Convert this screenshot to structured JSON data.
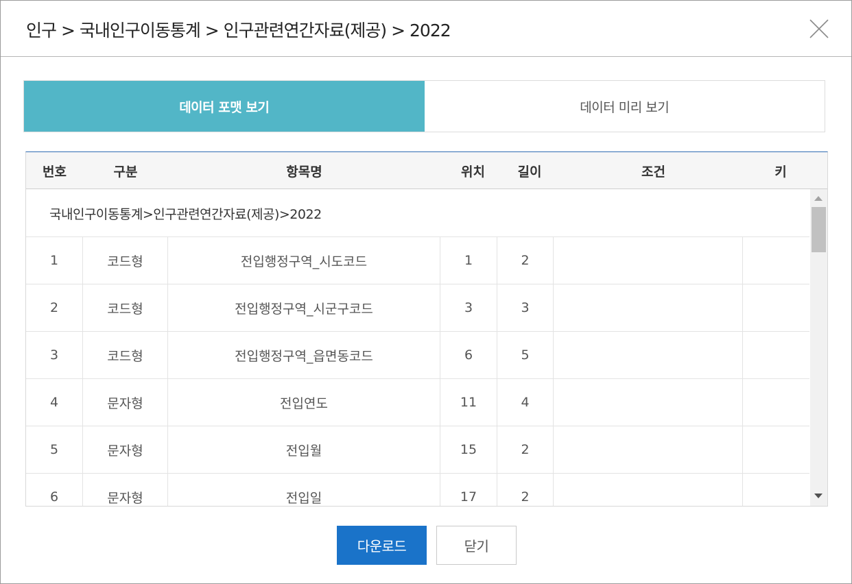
{
  "header": {
    "title": "인구 > 국내인구이동통계 > 인구관련연간자료(제공) > 2022",
    "close_icon": "close-icon"
  },
  "tabs": [
    {
      "label": "데이터 포맷 보기",
      "active": true
    },
    {
      "label": "데이터 미리 보기",
      "active": false
    }
  ],
  "table": {
    "columns": [
      "번호",
      "구분",
      "항목명",
      "위치",
      "길이",
      "조건",
      "키"
    ],
    "group_label": "국내인구이동통계>인구관련연간자료(제공)>2022",
    "rows": [
      {
        "no": "1",
        "type": "코드형",
        "name": "전입행정구역_시도코드",
        "pos": "1",
        "len": "2",
        "cond": "",
        "key": ""
      },
      {
        "no": "2",
        "type": "코드형",
        "name": "전입행정구역_시군구코드",
        "pos": "3",
        "len": "3",
        "cond": "",
        "key": ""
      },
      {
        "no": "3",
        "type": "코드형",
        "name": "전입행정구역_읍면동코드",
        "pos": "6",
        "len": "5",
        "cond": "",
        "key": ""
      },
      {
        "no": "4",
        "type": "문자형",
        "name": "전입연도",
        "pos": "11",
        "len": "4",
        "cond": "",
        "key": ""
      },
      {
        "no": "5",
        "type": "문자형",
        "name": "전입월",
        "pos": "15",
        "len": "2",
        "cond": "",
        "key": ""
      },
      {
        "no": "6",
        "type": "문자형",
        "name": "전입일",
        "pos": "17",
        "len": "2",
        "cond": "",
        "key": ""
      }
    ]
  },
  "buttons": {
    "download": "다운로드",
    "close": "닫기"
  },
  "colors": {
    "active_tab": "#52b6c7",
    "primary_button": "#1a73c9",
    "table_top_border": "#2f6bb2"
  }
}
